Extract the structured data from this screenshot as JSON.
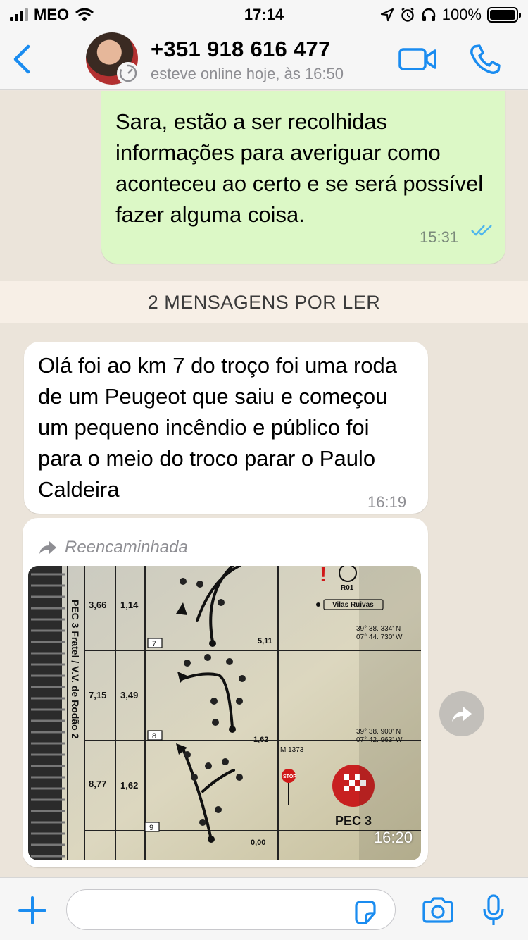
{
  "status_bar": {
    "carrier": "MEO",
    "time": "17:14",
    "battery": "100%"
  },
  "header": {
    "contact_name": "+351 918 616 477",
    "contact_status": "esteve online hoje, às 16:50"
  },
  "messages": [
    {
      "direction": "outgoing",
      "text": "Sara, estão a ser recolhidas informações para averiguar como aconteceu ao certo e se será possível fazer alguma coisa.",
      "time": "15:31",
      "status": "read"
    },
    {
      "direction": "incoming",
      "text": "Olá foi ao km 7 do troço foi uma roda de um Peugeot que saiu e começou um pequeno incêndio e público foi para o meio do troco parar o Paulo Caldeira",
      "time": "16:19"
    },
    {
      "direction": "incoming",
      "forwarded_label": "Reencaminhada",
      "time": "16:20",
      "photo": {
        "side_title": "PEC 3 Fratel / V.V. de Rodão 2",
        "rows": [
          {
            "a": "3,66",
            "b": "1,14",
            "box": "7",
            "dist": "5,11"
          },
          {
            "a": "7,15",
            "b": "3,49",
            "box": "8",
            "dist": "1,62"
          },
          {
            "a": "8,77",
            "b": "1,62",
            "box": "9",
            "dist": "0,00"
          }
        ],
        "r01": "R01",
        "vilas": "Vilas Ruivas",
        "coord1_n": "39° 38. 334' N",
        "coord1_w": "07° 44. 730' W",
        "coord2_n": "39° 38. 900' N",
        "coord2_w": "07° 42. 963' W",
        "m1373": "M 1373",
        "stop": "STOP",
        "pec3": "PEC 3"
      }
    }
  ],
  "unread_banner": "2 MENSAGENS POR LER",
  "input": {
    "placeholder": ""
  },
  "colors": {
    "accent": "#1a8cf0",
    "outgoing_bubble": "#dcf8c6",
    "incoming_bubble": "#ffffff",
    "read_ticks": "#4fb6ec"
  },
  "icons": [
    "back-chevron-icon",
    "video-call-icon",
    "phone-icon",
    "forward-arrow-icon",
    "share-icon",
    "plus-icon",
    "sticker-icon",
    "camera-icon",
    "microphone-icon",
    "double-check-icon"
  ]
}
